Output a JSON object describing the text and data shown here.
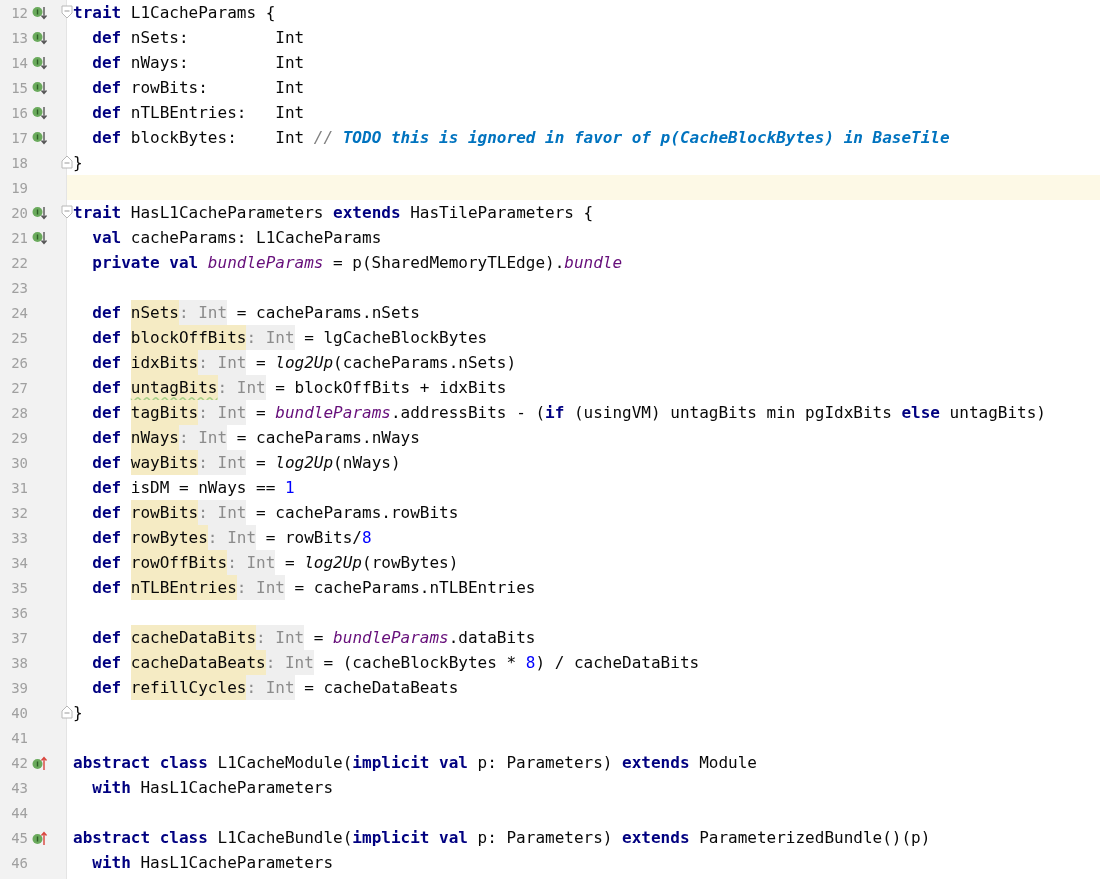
{
  "editor": {
    "lines": [
      {
        "number": "12",
        "marker": {
          "kind": "down"
        },
        "fold": {
          "kind": "open"
        },
        "current": false,
        "tokens": [
          {
            "kind": "kw",
            "text": "trait"
          },
          {
            "kind": "plain",
            "text": " L1CacheParams {"
          }
        ]
      },
      {
        "number": "13",
        "marker": {
          "kind": "down"
        },
        "current": false,
        "tokens": [
          {
            "kind": "kw",
            "text": "  def"
          },
          {
            "kind": "plain",
            "text": " nSets:         Int"
          }
        ]
      },
      {
        "number": "14",
        "marker": {
          "kind": "down"
        },
        "current": false,
        "tokens": [
          {
            "kind": "kw",
            "text": "  def"
          },
          {
            "kind": "plain",
            "text": " nWays:         Int"
          }
        ]
      },
      {
        "number": "15",
        "marker": {
          "kind": "down"
        },
        "current": false,
        "tokens": [
          {
            "kind": "kw",
            "text": "  def"
          },
          {
            "kind": "plain",
            "text": " rowBits:       Int"
          }
        ]
      },
      {
        "number": "16",
        "marker": {
          "kind": "down"
        },
        "current": false,
        "tokens": [
          {
            "kind": "kw",
            "text": "  def"
          },
          {
            "kind": "plain",
            "text": " nTLBEntries:   Int"
          }
        ]
      },
      {
        "number": "17",
        "marker": {
          "kind": "down"
        },
        "current": false,
        "tokens": [
          {
            "kind": "kw",
            "text": "  def"
          },
          {
            "kind": "plain",
            "text": " blockBytes:    Int "
          },
          {
            "kind": "comment",
            "text": "// "
          },
          {
            "kind": "todo",
            "text": "TODO this is ignored in favor of p(CacheBlockBytes) in BaseTile"
          }
        ]
      },
      {
        "number": "18",
        "fold": {
          "kind": "close"
        },
        "current": false,
        "tokens": [
          {
            "kind": "plain",
            "text": "}"
          }
        ]
      },
      {
        "number": "19",
        "current": true
      },
      {
        "number": "20",
        "marker": {
          "kind": "down"
        },
        "fold": {
          "kind": "open"
        },
        "current": false,
        "tokens": [
          {
            "kind": "kw",
            "text": "trait"
          },
          {
            "kind": "plain",
            "text": " HasL1CacheParameters "
          },
          {
            "kind": "kw",
            "text": "extends"
          },
          {
            "kind": "plain",
            "text": " HasTileParameters {"
          }
        ]
      },
      {
        "number": "21",
        "marker": {
          "kind": "down"
        },
        "current": false,
        "tokens": [
          {
            "kind": "kw",
            "text": "  val"
          },
          {
            "kind": "plain",
            "text": " cacheParams: L1CacheParams"
          }
        ]
      },
      {
        "number": "22",
        "current": false,
        "tokens": [
          {
            "kind": "kw",
            "text": "  private val "
          },
          {
            "kind": "field",
            "text": "bundleParams"
          },
          {
            "kind": "plain",
            "text": " = p(SharedMemoryTLEdge)."
          },
          {
            "kind": "field",
            "text": "bundle"
          }
        ]
      },
      {
        "number": "23",
        "current": false
      },
      {
        "number": "24",
        "current": false,
        "tokens": [
          {
            "kind": "kw",
            "text": "  def "
          },
          {
            "kind": "name",
            "text": "nSets"
          },
          {
            "kind": "hint",
            "text": ": Int"
          },
          {
            "kind": "plain",
            "text": " = cacheParams.nSets"
          }
        ]
      },
      {
        "number": "25",
        "current": false,
        "tokens": [
          {
            "kind": "kw",
            "text": "  def "
          },
          {
            "kind": "name",
            "text": "blockOffBits"
          },
          {
            "kind": "hint",
            "text": ": Int"
          },
          {
            "kind": "plain",
            "text": " = lgCacheBlockBytes"
          }
        ]
      },
      {
        "number": "26",
        "current": false,
        "tokens": [
          {
            "kind": "kw",
            "text": "  def "
          },
          {
            "kind": "name",
            "text": "idxBits"
          },
          {
            "kind": "hint",
            "text": ": Int"
          },
          {
            "kind": "plain",
            "text": " = "
          },
          {
            "kind": "call",
            "text": "log2Up"
          },
          {
            "kind": "plain",
            "text": "(cacheParams.nSets)"
          }
        ]
      },
      {
        "number": "27",
        "current": false,
        "tokens": [
          {
            "kind": "kw",
            "text": "  def "
          },
          {
            "kind": "warn",
            "text": "untagBits"
          },
          {
            "kind": "hint",
            "text": ": Int"
          },
          {
            "kind": "plain",
            "text": " = blockOffBits + idxBits"
          }
        ]
      },
      {
        "number": "28",
        "current": false,
        "tokens": [
          {
            "kind": "kw",
            "text": "  def "
          },
          {
            "kind": "name",
            "text": "tagBits"
          },
          {
            "kind": "hint",
            "text": ": Int"
          },
          {
            "kind": "plain",
            "text": " = "
          },
          {
            "kind": "field",
            "text": "bundleParams"
          },
          {
            "kind": "plain",
            "text": ".addressBits - ("
          },
          {
            "kind": "kw",
            "text": "if"
          },
          {
            "kind": "plain",
            "text": " (usingVM) untagBits min pgIdxBits "
          },
          {
            "kind": "kw",
            "text": "else"
          },
          {
            "kind": "plain",
            "text": " untagBits)"
          }
        ]
      },
      {
        "number": "29",
        "current": false,
        "tokens": [
          {
            "kind": "kw",
            "text": "  def "
          },
          {
            "kind": "name",
            "text": "nWays"
          },
          {
            "kind": "hint",
            "text": ": Int"
          },
          {
            "kind": "plain",
            "text": " = cacheParams.nWays"
          }
        ]
      },
      {
        "number": "30",
        "current": false,
        "tokens": [
          {
            "kind": "kw",
            "text": "  def "
          },
          {
            "kind": "name",
            "text": "wayBits"
          },
          {
            "kind": "hint",
            "text": ": Int"
          },
          {
            "kind": "plain",
            "text": " = "
          },
          {
            "kind": "call",
            "text": "log2Up"
          },
          {
            "kind": "plain",
            "text": "(nWays)"
          }
        ]
      },
      {
        "number": "31",
        "current": false,
        "tokens": [
          {
            "kind": "kw",
            "text": "  def"
          },
          {
            "kind": "plain",
            "text": " isDM = nWays == "
          },
          {
            "kind": "num",
            "text": "1"
          }
        ]
      },
      {
        "number": "32",
        "current": false,
        "tokens": [
          {
            "kind": "kw",
            "text": "  def "
          },
          {
            "kind": "name",
            "text": "rowBits"
          },
          {
            "kind": "hint",
            "text": ": Int"
          },
          {
            "kind": "plain",
            "text": " = cacheParams.rowBits"
          }
        ]
      },
      {
        "number": "33",
        "current": false,
        "tokens": [
          {
            "kind": "kw",
            "text": "  def "
          },
          {
            "kind": "name",
            "text": "rowBytes"
          },
          {
            "kind": "hint",
            "text": ": Int"
          },
          {
            "kind": "plain",
            "text": " = rowBits/"
          },
          {
            "kind": "num",
            "text": "8"
          }
        ]
      },
      {
        "number": "34",
        "current": false,
        "tokens": [
          {
            "kind": "kw",
            "text": "  def "
          },
          {
            "kind": "name",
            "text": "rowOffBits"
          },
          {
            "kind": "hint",
            "text": ": Int"
          },
          {
            "kind": "plain",
            "text": " = "
          },
          {
            "kind": "call",
            "text": "log2Up"
          },
          {
            "kind": "plain",
            "text": "(rowBytes)"
          }
        ]
      },
      {
        "number": "35",
        "current": false,
        "tokens": [
          {
            "kind": "kw",
            "text": "  def "
          },
          {
            "kind": "name",
            "text": "nTLBEntries"
          },
          {
            "kind": "hint",
            "text": ": Int"
          },
          {
            "kind": "plain",
            "text": " = cacheParams.nTLBEntries"
          }
        ]
      },
      {
        "number": "36",
        "current": false
      },
      {
        "number": "37",
        "current": false,
        "tokens": [
          {
            "kind": "kw",
            "text": "  def "
          },
          {
            "kind": "name",
            "text": "cacheDataBits"
          },
          {
            "kind": "hint",
            "text": ": Int"
          },
          {
            "kind": "plain",
            "text": " = "
          },
          {
            "kind": "field",
            "text": "bundleParams"
          },
          {
            "kind": "plain",
            "text": ".dataBits"
          }
        ]
      },
      {
        "number": "38",
        "current": false,
        "tokens": [
          {
            "kind": "kw",
            "text": "  def "
          },
          {
            "kind": "name",
            "text": "cacheDataBeats"
          },
          {
            "kind": "hint",
            "text": ": Int"
          },
          {
            "kind": "plain",
            "text": " = (cacheBlockBytes * "
          },
          {
            "kind": "num",
            "text": "8"
          },
          {
            "kind": "plain",
            "text": ") / cacheDataBits"
          }
        ]
      },
      {
        "number": "39",
        "current": false,
        "tokens": [
          {
            "kind": "kw",
            "text": "  def "
          },
          {
            "kind": "name",
            "text": "refillCycles"
          },
          {
            "kind": "hint",
            "text": ": Int"
          },
          {
            "kind": "plain",
            "text": " = cacheDataBeats"
          }
        ]
      },
      {
        "number": "40",
        "fold": {
          "kind": "close"
        },
        "current": false,
        "tokens": [
          {
            "kind": "plain",
            "text": "}"
          }
        ]
      },
      {
        "number": "41",
        "current": false
      },
      {
        "number": "42",
        "marker": {
          "kind": "up"
        },
        "current": false,
        "tokens": [
          {
            "kind": "kw",
            "text": "abstract class"
          },
          {
            "kind": "plain",
            "text": " L1CacheModule("
          },
          {
            "kind": "kw",
            "text": "implicit val"
          },
          {
            "kind": "plain",
            "text": " p: Parameters) "
          },
          {
            "kind": "kw",
            "text": "extends"
          },
          {
            "kind": "plain",
            "text": " Module"
          }
        ]
      },
      {
        "number": "43",
        "current": false,
        "tokens": [
          {
            "kind": "kw",
            "text": "  with"
          },
          {
            "kind": "plain",
            "text": " HasL1CacheParameters"
          }
        ]
      },
      {
        "number": "44",
        "current": false
      },
      {
        "number": "45",
        "marker": {
          "kind": "up"
        },
        "current": false,
        "tokens": [
          {
            "kind": "kw",
            "text": "abstract class"
          },
          {
            "kind": "plain",
            "text": " L1CacheBundle("
          },
          {
            "kind": "kw",
            "text": "implicit val"
          },
          {
            "kind": "plain",
            "text": " p: Parameters) "
          },
          {
            "kind": "kw",
            "text": "extends"
          },
          {
            "kind": "plain",
            "text": " ParameterizedBundle()(p)"
          }
        ]
      },
      {
        "number": "46",
        "current": false,
        "tokens": [
          {
            "kind": "kw",
            "text": "  with"
          },
          {
            "kind": "plain",
            "text": " HasL1CacheParameters"
          }
        ]
      }
    ]
  }
}
